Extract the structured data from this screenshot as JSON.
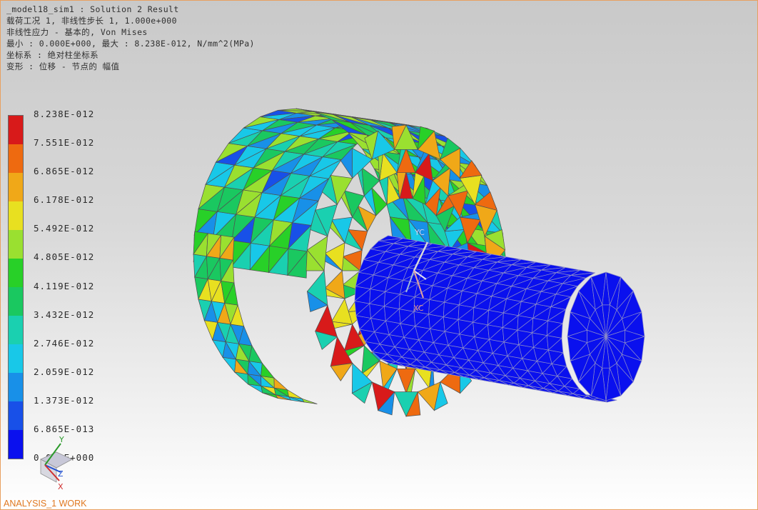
{
  "header": {
    "lines": [
      "_model18_sim1 : Solution 2 Result",
      "载荷工况 1, 非线性步长 1, 1.000e+000",
      "非线性应力 - 基本的, Von Mises",
      "最小 : 0.000E+000, 最大 : 8.238E-012, N/mm^2(MPa)",
      "坐标系 : 绝对柱坐标系",
      "变形 : 位移 - 节点的 幅值"
    ]
  },
  "legend": {
    "labels": [
      "8.238E-012",
      "7.551E-012",
      "6.865E-012",
      "6.178E-012",
      "5.492E-012",
      "4.805E-012",
      "4.119E-012",
      "3.432E-012",
      "2.746E-012",
      "2.059E-012",
      "1.373E-012",
      "6.865E-013",
      "0.000E+000"
    ],
    "colors": [
      "#d81a1a",
      "#ee6a10",
      "#f0a818",
      "#e8e020",
      "#9ae030",
      "#28d028",
      "#1ac860",
      "#1ad0b0",
      "#18c8e8",
      "#1890e8",
      "#1850e8",
      "#0a10ee"
    ]
  },
  "csys_triad": {
    "y_label": "YC",
    "x_label": "XC"
  },
  "wcs_triad": {
    "y_label": "Y",
    "z_label": "Z",
    "x_label": "X"
  },
  "wcs_name": "ANALYSIS_1 WORK",
  "stress_colors": [
    "#0a10ee",
    "#1850e8",
    "#1890e8",
    "#18c8e8",
    "#1ad0b0",
    "#1ac860",
    "#28d028",
    "#9ae030",
    "#e8e020",
    "#f0a818",
    "#ee6a10",
    "#d81a1a"
  ]
}
